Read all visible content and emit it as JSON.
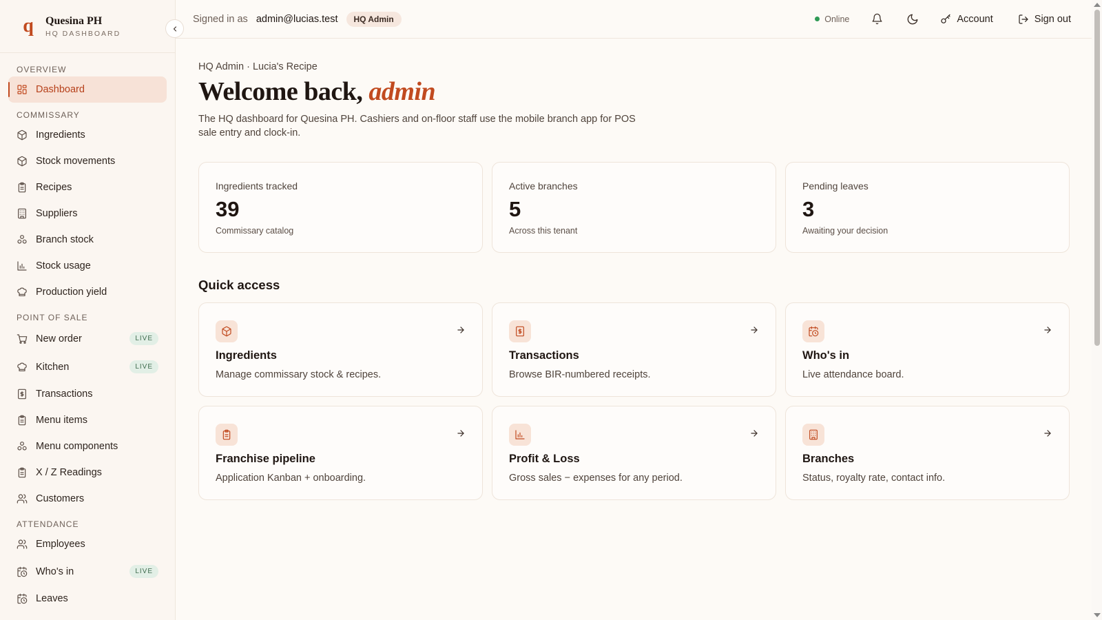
{
  "brand": {
    "logo_letter": "q",
    "name": "Quesina PH",
    "subtitle": "HQ DASHBOARD"
  },
  "sidebar": {
    "sections": [
      {
        "title": "OVERVIEW",
        "items": [
          {
            "label": "Dashboard",
            "icon": "dashboard-icon",
            "active": true
          }
        ]
      },
      {
        "title": "COMMISSARY",
        "items": [
          {
            "label": "Ingredients",
            "icon": "box-icon"
          },
          {
            "label": "Stock movements",
            "icon": "box-icon"
          },
          {
            "label": "Recipes",
            "icon": "clipboard-icon"
          },
          {
            "label": "Suppliers",
            "icon": "building-icon"
          },
          {
            "label": "Branch stock",
            "icon": "branch-icon"
          },
          {
            "label": "Stock usage",
            "icon": "bar-chart-icon"
          },
          {
            "label": "Production yield",
            "icon": "chef-hat-icon"
          }
        ]
      },
      {
        "title": "POINT OF SALE",
        "items": [
          {
            "label": "New order",
            "icon": "cart-icon",
            "badge": "LIVE"
          },
          {
            "label": "Kitchen",
            "icon": "chef-hat-icon",
            "badge": "LIVE"
          },
          {
            "label": "Transactions",
            "icon": "receipt-icon"
          },
          {
            "label": "Menu items",
            "icon": "clipboard-icon"
          },
          {
            "label": "Menu components",
            "icon": "branch-icon"
          },
          {
            "label": "X / Z Readings",
            "icon": "clipboard-icon"
          },
          {
            "label": "Customers",
            "icon": "users-icon"
          }
        ]
      },
      {
        "title": "ATTENDANCE",
        "items": [
          {
            "label": "Employees",
            "icon": "users-icon"
          },
          {
            "label": "Who's in",
            "icon": "calendar-clock-icon",
            "badge": "LIVE"
          },
          {
            "label": "Leaves",
            "icon": "calendar-clock-icon"
          }
        ]
      }
    ]
  },
  "topbar": {
    "signed_in_label": "Signed in as",
    "email": "admin@lucias.test",
    "role": "HQ Admin",
    "status": "Online",
    "status_color": "#2f9a55",
    "account_label": "Account",
    "signout_label": "Sign out"
  },
  "main": {
    "breadcrumb": "HQ Admin · Lucia's Recipe",
    "welcome_prefix": "Welcome back,",
    "welcome_user": "admin",
    "intro": "The HQ dashboard for Quesina PH. Cashiers and on-floor staff use the mobile branch app for POS sale entry and clock-in.",
    "stats": [
      {
        "label": "Ingredients tracked",
        "value": "39",
        "sub": "Commissary catalog"
      },
      {
        "label": "Active branches",
        "value": "5",
        "sub": "Across this tenant"
      },
      {
        "label": "Pending leaves",
        "value": "3",
        "sub": "Awaiting your decision"
      }
    ],
    "quick_access_title": "Quick access",
    "quick_access": [
      {
        "title": "Ingredients",
        "desc": "Manage commissary stock & recipes.",
        "icon": "box-icon"
      },
      {
        "title": "Transactions",
        "desc": "Browse BIR-numbered receipts.",
        "icon": "receipt-icon"
      },
      {
        "title": "Who's in",
        "desc": "Live attendance board.",
        "icon": "calendar-clock-icon"
      },
      {
        "title": "Franchise pipeline",
        "desc": "Application Kanban + onboarding.",
        "icon": "clipboard-icon"
      },
      {
        "title": "Profit & Loss",
        "desc": "Gross sales − expenses for any period.",
        "icon": "bar-chart-icon"
      },
      {
        "title": "Branches",
        "desc": "Status, royalty rate, contact info.",
        "icon": "building-icon"
      }
    ]
  },
  "colors": {
    "accent": "#c14a1f",
    "live_badge_bg": "#e2efe6",
    "live_badge_text": "#3f6b4e"
  }
}
